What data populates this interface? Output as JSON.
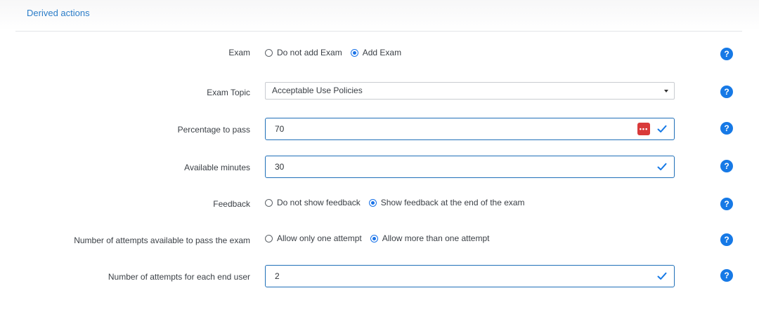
{
  "section": {
    "title": "Derived actions"
  },
  "exam": {
    "label": "Exam",
    "options": [
      "Do not add Exam",
      "Add Exam"
    ],
    "selected": 1
  },
  "exam_topic": {
    "label": "Exam Topic",
    "value": "Acceptable Use Policies"
  },
  "percentage": {
    "label": "Percentage to pass",
    "value": "70"
  },
  "minutes": {
    "label": "Available minutes",
    "value": "30"
  },
  "feedback": {
    "label": "Feedback",
    "options": [
      "Do not show feedback",
      "Show feedback at the end of the exam"
    ],
    "selected": 1
  },
  "attempts_mode": {
    "label": "Number of attempts available to pass the exam",
    "options": [
      "Allow only one attempt",
      "Allow more than one attempt"
    ],
    "selected": 1
  },
  "attempts_count": {
    "label": "Number of attempts for each end user",
    "value": "2"
  },
  "help": {
    "glyph": "?"
  },
  "colors": {
    "accent": "#1679e6",
    "input_border": "#1f6fb8",
    "title": "#2b7dc8",
    "password_badge": "#d93a3a"
  },
  "icons": {
    "help": "help-icon",
    "check": "check-icon",
    "caret": "chevron-down-icon",
    "password": "password-manager-icon"
  }
}
